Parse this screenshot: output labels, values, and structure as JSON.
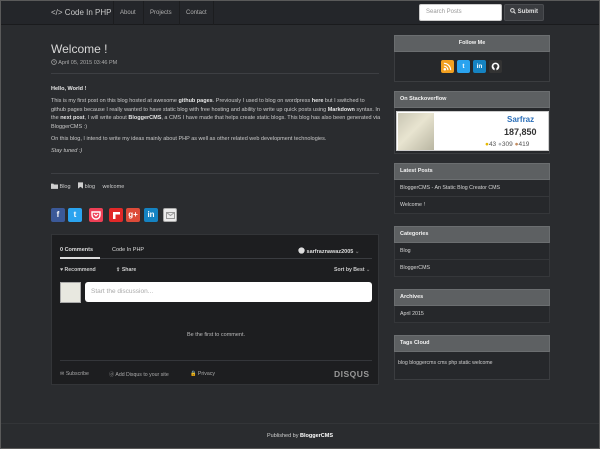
{
  "nav": {
    "brand": "</> Code In PHP",
    "links": [
      "About",
      "Projects",
      "Contact"
    ],
    "search_placeholder": "Search Posts",
    "submit_label": "Submit"
  },
  "post": {
    "title": "Welcome !",
    "date": "April 05, 2015 03:46 PM",
    "greeting": "Hello, World !",
    "para1_a": "This is my first post on this blog hosted at awesome ",
    "para1_link1": "github pages",
    "para1_b": ". Previously I used to blog on wordpress ",
    "para1_link2": "here",
    "para1_c": " but I switched to github pages because I really wanted to have static blog with free hosting and ability to write up quick posts using ",
    "para1_link3": "Markdown",
    "para1_d": " syntax. In the ",
    "para1_link4": "next post",
    "para1_e": ", I will write about ",
    "para1_link5": "BloggerCMS",
    "para1_f": ", a CMS I have made that helps create static blogs. This blog has also been generated via BloggerCMS :)",
    "para2": "On this blog, I intend to write my ideas mainly about PHP as well as other related web development technologies.",
    "para3": "Stay tuned :)",
    "category": "Blog",
    "tags": [
      "blog",
      "welcome"
    ]
  },
  "share_icons": [
    "facebook-icon",
    "twitter-icon",
    "pocket-icon",
    "flipboard-icon",
    "googleplus-icon",
    "linkedin-icon",
    "email-icon"
  ],
  "disqus": {
    "tab_comments": "0 Comments",
    "tab_site": "Code In PHP",
    "user": "sarfraznawaz2005",
    "recommend": "Recommend",
    "share": "Share",
    "sort": "Sort by Best",
    "placeholder": "Start the discussion...",
    "empty": "Be the first to comment.",
    "subscribe": "Subscribe",
    "add_disqus": "Add Disqus to your site",
    "privacy": "Privacy",
    "logo": "DISQUS"
  },
  "sidebar": {
    "follow_title": "Follow Me",
    "follow_icons": [
      "rss-icon",
      "twitter-icon",
      "linkedin-icon",
      "github-icon"
    ],
    "so_title": "On Stackoverflow",
    "so_name": "Sarfraz",
    "so_rep": "187,850",
    "so_gold": "43",
    "so_silver": "309",
    "so_bronze": "419",
    "latest_title": "Latest Posts",
    "latest": [
      "BloggerCMS - An Static Blog Creator CMS",
      "Welcome !"
    ],
    "categories_title": "Categories",
    "categories": [
      "Blog",
      "BloggerCMS"
    ],
    "archives_title": "Archives",
    "archives": [
      "April 2015"
    ],
    "tags_title": "Tags Cloud",
    "tags_cloud": "blog bloggercms cms php static welcome"
  },
  "footer": {
    "prefix": "Published by ",
    "brand": "BloggerCMS"
  },
  "colors": {
    "background": "#2a2c2f",
    "panel_head": "#5d6062",
    "rss": "#f2a020",
    "twitter": "#2aa3ef",
    "linkedin": "#1583c2",
    "github": "#333333"
  }
}
